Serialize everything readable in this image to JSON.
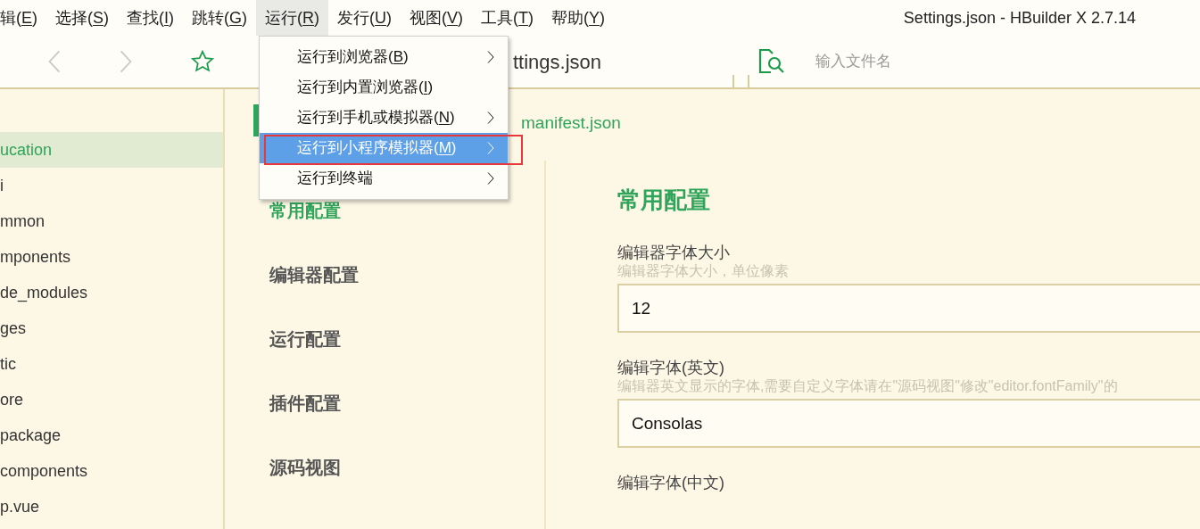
{
  "window": {
    "title": "Settings.json - HBuilder X 2.7.14"
  },
  "menu_bar": [
    {
      "before": "辑(",
      "key": "E",
      "after": ")",
      "selected": false
    },
    {
      "before": "选择(",
      "key": "S",
      "after": ")",
      "selected": false
    },
    {
      "before": "查找(",
      "key": "I",
      "after": ")",
      "selected": false
    },
    {
      "before": "跳转(",
      "key": "G",
      "after": ")",
      "selected": false
    },
    {
      "before": "运行(",
      "key": "R",
      "after": ")",
      "selected": true
    },
    {
      "before": "发行(",
      "key": "U",
      "after": ")",
      "selected": false
    },
    {
      "before": "视图(",
      "key": "V",
      "after": ")",
      "selected": false
    },
    {
      "before": "工具(",
      "key": "T",
      "after": ")",
      "selected": false
    },
    {
      "before": "帮助(",
      "key": "Y",
      "after": ")",
      "selected": false
    }
  ],
  "run_menu": [
    {
      "before": "运行到浏览器(",
      "key": "B",
      "after": ")",
      "submenu": true,
      "selected": false
    },
    {
      "before": "运行到内置浏览器(",
      "key": "I",
      "after": ")",
      "submenu": false,
      "selected": false
    },
    {
      "before": "运行到手机或模拟器(",
      "key": "N",
      "after": ")",
      "submenu": true,
      "selected": false
    },
    {
      "before": "运行到小程序模拟器(",
      "key": "M",
      "after": ")",
      "submenu": true,
      "selected": true
    },
    {
      "before": "运行到终端",
      "submenu": true,
      "selected": false
    }
  ],
  "toolbar": {
    "file_tab": "ttings.json",
    "search": {
      "placeholder": "输入文件名"
    }
  },
  "sidebar": {
    "items": [
      {
        "label": "ucation",
        "selected": true
      },
      {
        "label": "i",
        "selected": false
      },
      {
        "label": "mmon",
        "selected": false
      },
      {
        "label": "mponents",
        "selected": false
      },
      {
        "label": "de_modules",
        "selected": false
      },
      {
        "label": "ges",
        "selected": false
      },
      {
        "label": "tic",
        "selected": false
      },
      {
        "label": "ore",
        "selected": false
      },
      {
        "label": "package",
        "selected": false
      },
      {
        "label": "components",
        "selected": false
      },
      {
        "label": "p.vue",
        "selected": false
      }
    ]
  },
  "editor_tab": "manifest.json",
  "settings_nav": [
    {
      "label": "常用配置",
      "selected": true
    },
    {
      "label": "编辑器配置",
      "selected": false
    },
    {
      "label": "运行配置",
      "selected": false
    },
    {
      "label": "插件配置",
      "selected": false
    },
    {
      "label": "源码视图",
      "selected": false
    }
  ],
  "settings": {
    "heading": "常用配置",
    "fields": [
      {
        "label": "编辑器字体大小",
        "hint": "编辑器字体大小，单位像素",
        "value": "12"
      },
      {
        "label": "编辑字体(英文)",
        "hint": "编辑器英文显示的字体,需要自定义字体请在\"源码视图\"修改\"editor.fontFamily\"的",
        "value": "Consolas"
      },
      {
        "label": "编辑字体(中文)"
      }
    ]
  }
}
